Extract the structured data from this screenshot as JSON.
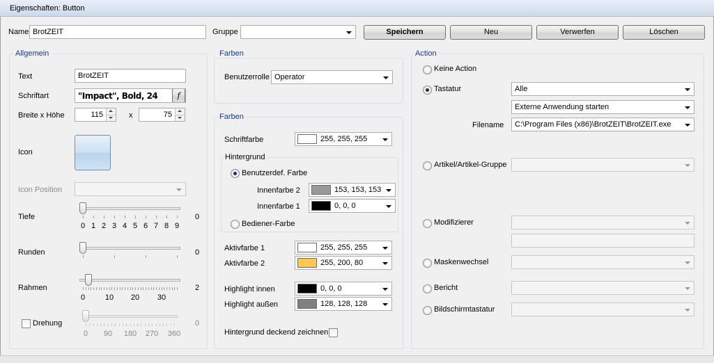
{
  "window": {
    "title": "Eigenschaften: Button"
  },
  "toolbar": {
    "name_label": "Name",
    "name_value": "BrotZEIT",
    "gruppe_label": "Gruppe",
    "gruppe_value": "",
    "save": "Speichern",
    "new": "Neu",
    "discard": "Verwerfen",
    "delete": "Löschen"
  },
  "allgemein": {
    "title": "Allgemein",
    "text_label": "Text",
    "text_value": "BrotZEIT",
    "font_label": "Schriftart",
    "font_value": "\"Impact\", Bold, 24",
    "font_button": "f",
    "size_label": "Breite x Höhe",
    "width": "115",
    "x": "x",
    "height": "75",
    "icon_label": "Icon",
    "icon_position_label": "Icon Position",
    "icon_position_value": "",
    "tiefe": {
      "label": "Tiefe",
      "value": 0,
      "display": "0",
      "min": 0,
      "max": 9,
      "ticks": [
        "0",
        "1",
        "2",
        "3",
        "4",
        "5",
        "6",
        "7",
        "8",
        "9"
      ]
    },
    "runden": {
      "label": "Runden",
      "value": 0,
      "display": "0",
      "min": 0,
      "max": 50
    },
    "rahmen": {
      "label": "Rahmen",
      "value": 2,
      "display": "2",
      "min": 0,
      "max": 36,
      "ticks": [
        "0",
        "10",
        "20",
        "30"
      ]
    },
    "drehung": {
      "label": "Drehung",
      "checked": false,
      "value": 0,
      "display": "0",
      "min": 0,
      "max": 360,
      "ticks": [
        "0",
        "90",
        "180",
        "270",
        "360"
      ]
    }
  },
  "farben1": {
    "title": "Farben",
    "role_label": "Benutzerrolle",
    "role_value": "Operator"
  },
  "farben2": {
    "title": "Farben",
    "schriftfarbe_label": "Schriftfarbe",
    "schriftfarbe": {
      "color": "#ffffff",
      "text": "255, 255, 255"
    },
    "hintergrund_title": "Hintergrund",
    "benutzerdef_label": "Benutzerdef. Farbe",
    "benutzerdef_selected": true,
    "innen2_label": "Innenfarbe 2",
    "innen2": {
      "color": "#999999",
      "text": "153, 153, 153"
    },
    "innen1_label": "Innenfarbe 1",
    "innen1": {
      "color": "#000000",
      "text": "0, 0, 0"
    },
    "bediener_label": "Bediener-Farbe",
    "aktiv1_label": "Aktivfarbe 1",
    "aktiv1": {
      "color": "#ffffff",
      "text": "255, 255, 255"
    },
    "aktiv2_label": "Aktivfarbe 2",
    "aktiv2": {
      "color": "#ffc850",
      "text": "255, 200, 80"
    },
    "hl_innen_label": "Highlight innen",
    "hl_innen": {
      "color": "#000000",
      "text": "0, 0, 0"
    },
    "hl_aussen_label": "Highlight außen",
    "hl_aussen": {
      "color": "#808080",
      "text": "128, 128, 128"
    },
    "deckend_label": "Hintergrund deckend zeichnen",
    "deckend_checked": false
  },
  "action": {
    "title": "Action",
    "keine_label": "Keine Action",
    "tastatur_label": "Tastatur",
    "tastatur_selected": true,
    "tastatur_value": "Alle",
    "tastatur_action": "Externe Anwendung starten",
    "filename_label": "Filename",
    "filename_value": "C:\\Program Files (x86)\\BrotZEIT\\BrotZEIT.exe",
    "artikel_label": "Artikel/Artikel-Gruppe",
    "modifizierer_label": "Modifizierer",
    "maskenwechsel_label": "Maskenwechsel",
    "bericht_label": "Bericht",
    "bildschirm_label": "Bildschirmtastatur"
  }
}
